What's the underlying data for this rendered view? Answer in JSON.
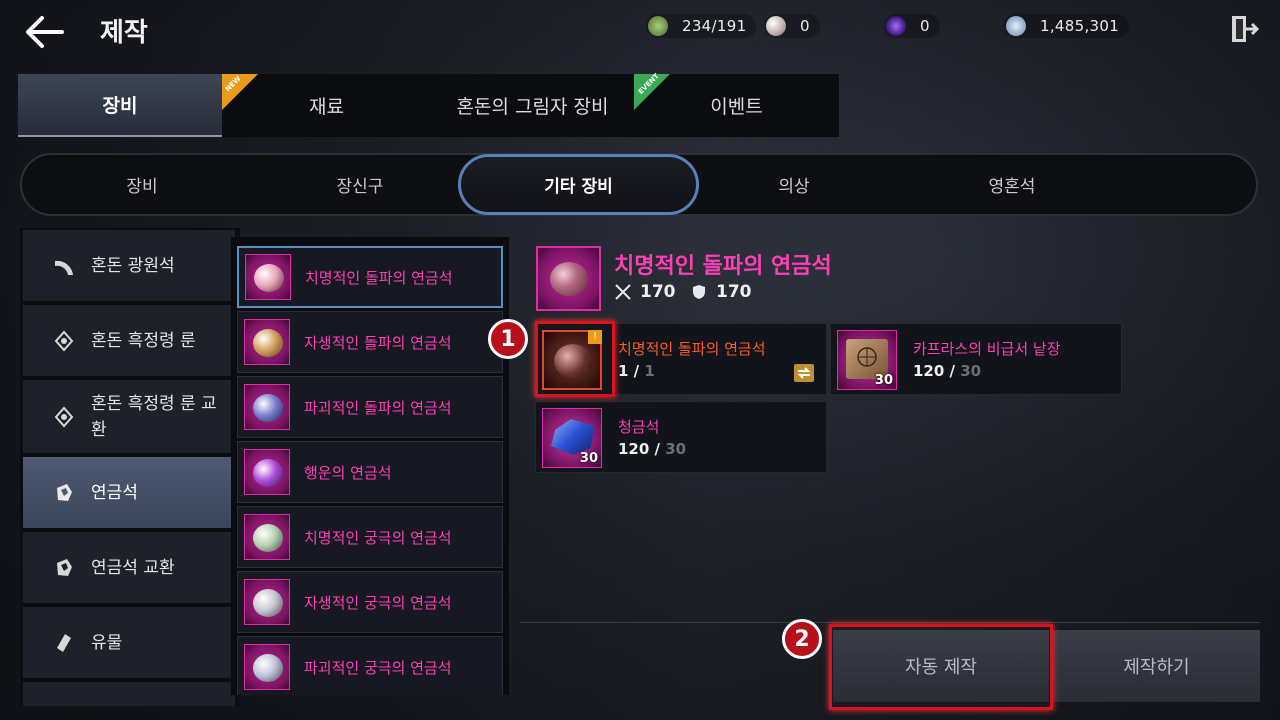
{
  "header": {
    "title": "제작",
    "currencies": [
      {
        "icon": "energy-gem-icon",
        "value": "234/191",
        "color": "#6f9a4f"
      },
      {
        "icon": "pearl-icon",
        "value": "0",
        "color": "#d9c9c9"
      },
      {
        "icon": "purple-orb-icon",
        "value": "0",
        "color": "#5c2aa8"
      },
      {
        "icon": "silver-coin-icon",
        "value": "1,485,301",
        "color": "#b8c6dd"
      }
    ]
  },
  "main_tabs": [
    {
      "label": "장비",
      "active": true,
      "badge": ""
    },
    {
      "label": "재료",
      "active": false,
      "badge": "NEW"
    },
    {
      "label": "혼돈의 그림자 장비",
      "active": false,
      "badge": ""
    },
    {
      "label": "이벤트",
      "active": false,
      "badge": "EVENT"
    }
  ],
  "sub_tabs": [
    {
      "label": "장비",
      "active": false
    },
    {
      "label": "장신구",
      "active": false
    },
    {
      "label": "기타 장비",
      "active": true
    },
    {
      "label": "의상",
      "active": false
    },
    {
      "label": "영혼석",
      "active": false
    }
  ],
  "categories": [
    {
      "label": "혼돈 광원석",
      "icon": "light-fan-icon",
      "active": false
    },
    {
      "label": "혼돈 흑정령 룬",
      "icon": "rune-diamond-icon",
      "active": false
    },
    {
      "label": "혼돈 흑정령 룬 교환",
      "icon": "rune-diamond-icon",
      "active": false
    },
    {
      "label": "연금석",
      "icon": "alchemy-stone-icon",
      "active": true
    },
    {
      "label": "연금석 교환",
      "icon": "alchemy-stone-icon",
      "active": false
    },
    {
      "label": "유물",
      "icon": "relic-icon",
      "active": false
    }
  ],
  "items": [
    {
      "label": "치명적인 돌파의 연금석",
      "gem": "#e6a7b9",
      "active": true
    },
    {
      "label": "자생적인 돌파의 연금석",
      "gem": "#d7a25f",
      "active": false
    },
    {
      "label": "파괴적인 돌파의 연금석",
      "gem": "#7b7fd0",
      "active": false
    },
    {
      "label": "행운의 연금석",
      "gem": "#b04fd8",
      "active": false
    },
    {
      "label": "치명적인 궁극의 연금석",
      "gem": "#b8d0b0",
      "active": false
    },
    {
      "label": "자생적인 궁극의 연금석",
      "gem": "#c7c7cf",
      "active": false
    },
    {
      "label": "파괴적인 궁극의 연금석",
      "gem": "#bfc4d8",
      "active": false
    }
  ],
  "detail": {
    "name": "치명적인 돌파의 연금석",
    "attack": "170",
    "defense": "170",
    "materials": [
      {
        "name": "치명적인 돌파의 연금석",
        "have": "1",
        "need": "1",
        "qty": "",
        "name_color": "#ff5a2c"
      },
      {
        "name": "카프라스의 비급서 낱장",
        "have": "120",
        "need": "30",
        "qty": "30",
        "name_color": "#ff3fb4"
      },
      {
        "name": "청금석",
        "have": "120",
        "need": "30",
        "qty": "30",
        "name_color": "#ff3fb4"
      }
    ]
  },
  "markers": [
    "1",
    "2"
  ],
  "buttons": {
    "auto_craft": "자동 제작",
    "craft": "제작하기"
  }
}
